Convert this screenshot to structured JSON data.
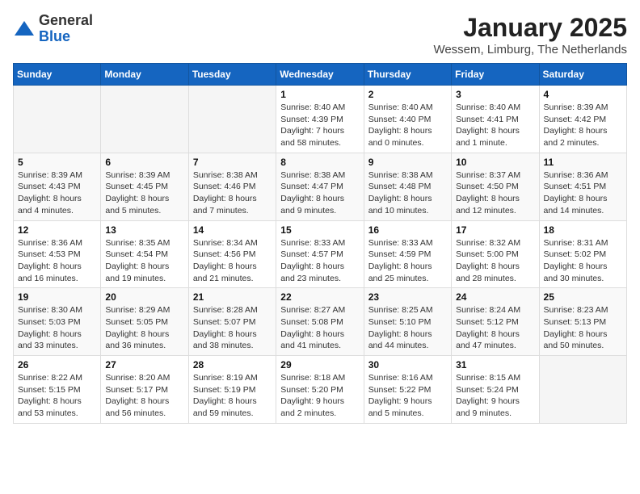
{
  "header": {
    "logo_general": "General",
    "logo_blue": "Blue",
    "title": "January 2025",
    "subtitle": "Wessem, Limburg, The Netherlands"
  },
  "weekdays": [
    "Sunday",
    "Monday",
    "Tuesday",
    "Wednesday",
    "Thursday",
    "Friday",
    "Saturday"
  ],
  "weeks": [
    [
      {
        "day": "",
        "info": ""
      },
      {
        "day": "",
        "info": ""
      },
      {
        "day": "",
        "info": ""
      },
      {
        "day": "1",
        "info": "Sunrise: 8:40 AM\nSunset: 4:39 PM\nDaylight: 7 hours\nand 58 minutes."
      },
      {
        "day": "2",
        "info": "Sunrise: 8:40 AM\nSunset: 4:40 PM\nDaylight: 8 hours\nand 0 minutes."
      },
      {
        "day": "3",
        "info": "Sunrise: 8:40 AM\nSunset: 4:41 PM\nDaylight: 8 hours\nand 1 minute."
      },
      {
        "day": "4",
        "info": "Sunrise: 8:39 AM\nSunset: 4:42 PM\nDaylight: 8 hours\nand 2 minutes."
      }
    ],
    [
      {
        "day": "5",
        "info": "Sunrise: 8:39 AM\nSunset: 4:43 PM\nDaylight: 8 hours\nand 4 minutes."
      },
      {
        "day": "6",
        "info": "Sunrise: 8:39 AM\nSunset: 4:45 PM\nDaylight: 8 hours\nand 5 minutes."
      },
      {
        "day": "7",
        "info": "Sunrise: 8:38 AM\nSunset: 4:46 PM\nDaylight: 8 hours\nand 7 minutes."
      },
      {
        "day": "8",
        "info": "Sunrise: 8:38 AM\nSunset: 4:47 PM\nDaylight: 8 hours\nand 9 minutes."
      },
      {
        "day": "9",
        "info": "Sunrise: 8:38 AM\nSunset: 4:48 PM\nDaylight: 8 hours\nand 10 minutes."
      },
      {
        "day": "10",
        "info": "Sunrise: 8:37 AM\nSunset: 4:50 PM\nDaylight: 8 hours\nand 12 minutes."
      },
      {
        "day": "11",
        "info": "Sunrise: 8:36 AM\nSunset: 4:51 PM\nDaylight: 8 hours\nand 14 minutes."
      }
    ],
    [
      {
        "day": "12",
        "info": "Sunrise: 8:36 AM\nSunset: 4:53 PM\nDaylight: 8 hours\nand 16 minutes."
      },
      {
        "day": "13",
        "info": "Sunrise: 8:35 AM\nSunset: 4:54 PM\nDaylight: 8 hours\nand 19 minutes."
      },
      {
        "day": "14",
        "info": "Sunrise: 8:34 AM\nSunset: 4:56 PM\nDaylight: 8 hours\nand 21 minutes."
      },
      {
        "day": "15",
        "info": "Sunrise: 8:33 AM\nSunset: 4:57 PM\nDaylight: 8 hours\nand 23 minutes."
      },
      {
        "day": "16",
        "info": "Sunrise: 8:33 AM\nSunset: 4:59 PM\nDaylight: 8 hours\nand 25 minutes."
      },
      {
        "day": "17",
        "info": "Sunrise: 8:32 AM\nSunset: 5:00 PM\nDaylight: 8 hours\nand 28 minutes."
      },
      {
        "day": "18",
        "info": "Sunrise: 8:31 AM\nSunset: 5:02 PM\nDaylight: 8 hours\nand 30 minutes."
      }
    ],
    [
      {
        "day": "19",
        "info": "Sunrise: 8:30 AM\nSunset: 5:03 PM\nDaylight: 8 hours\nand 33 minutes."
      },
      {
        "day": "20",
        "info": "Sunrise: 8:29 AM\nSunset: 5:05 PM\nDaylight: 8 hours\nand 36 minutes."
      },
      {
        "day": "21",
        "info": "Sunrise: 8:28 AM\nSunset: 5:07 PM\nDaylight: 8 hours\nand 38 minutes."
      },
      {
        "day": "22",
        "info": "Sunrise: 8:27 AM\nSunset: 5:08 PM\nDaylight: 8 hours\nand 41 minutes."
      },
      {
        "day": "23",
        "info": "Sunrise: 8:25 AM\nSunset: 5:10 PM\nDaylight: 8 hours\nand 44 minutes."
      },
      {
        "day": "24",
        "info": "Sunrise: 8:24 AM\nSunset: 5:12 PM\nDaylight: 8 hours\nand 47 minutes."
      },
      {
        "day": "25",
        "info": "Sunrise: 8:23 AM\nSunset: 5:13 PM\nDaylight: 8 hours\nand 50 minutes."
      }
    ],
    [
      {
        "day": "26",
        "info": "Sunrise: 8:22 AM\nSunset: 5:15 PM\nDaylight: 8 hours\nand 53 minutes."
      },
      {
        "day": "27",
        "info": "Sunrise: 8:20 AM\nSunset: 5:17 PM\nDaylight: 8 hours\nand 56 minutes."
      },
      {
        "day": "28",
        "info": "Sunrise: 8:19 AM\nSunset: 5:19 PM\nDaylight: 8 hours\nand 59 minutes."
      },
      {
        "day": "29",
        "info": "Sunrise: 8:18 AM\nSunset: 5:20 PM\nDaylight: 9 hours\nand 2 minutes."
      },
      {
        "day": "30",
        "info": "Sunrise: 8:16 AM\nSunset: 5:22 PM\nDaylight: 9 hours\nand 5 minutes."
      },
      {
        "day": "31",
        "info": "Sunrise: 8:15 AM\nSunset: 5:24 PM\nDaylight: 9 hours\nand 9 minutes."
      },
      {
        "day": "",
        "info": ""
      }
    ]
  ]
}
